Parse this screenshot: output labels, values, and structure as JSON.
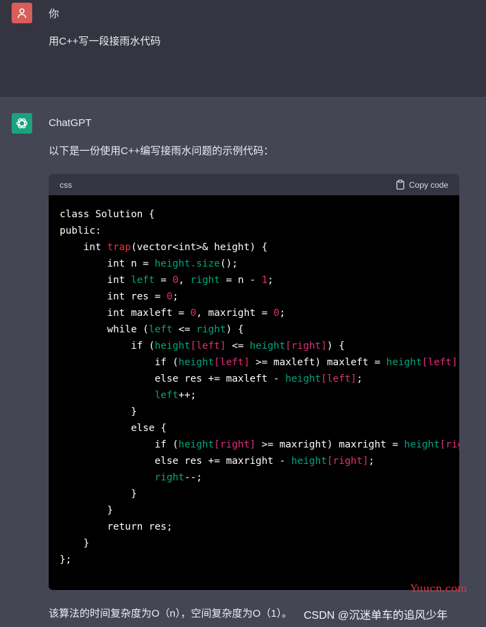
{
  "user": {
    "name": "你",
    "message": "用C++写一段接雨水代码"
  },
  "assistant": {
    "name": "ChatGPT",
    "intro": "以下是一份使用C++编写接雨水问题的示例代码："
  },
  "code_block": {
    "language": "css",
    "copy_label": "Copy code",
    "lines": [
      "class Solution {",
      "public:",
      "    int trap(vector<int>& height) {",
      "        int n = height.size();",
      "        int left = 0, right = n - 1;",
      "        int res = 0;",
      "        int maxleft = 0, maxright = 0;",
      "        while (left <= right) {",
      "            if (height[left] <= height[right]) {",
      "                if (height[left] >= maxleft) maxleft = height[left];",
      "                else res += maxleft - height[left];",
      "                left++;",
      "            }",
      "            else {",
      "                if (height[right] >= maxright) maxright = height[right];",
      "                else res += maxright - height[right];",
      "                right--;",
      "            }",
      "        }",
      "        return res;",
      "    }",
      "};"
    ]
  },
  "footer_text": "该算法的时间复杂度为O（n），空间复杂度为O（1）。",
  "watermarks": {
    "site": "Yuucn.com",
    "csdn": "CSDN @沉迷单车的追风少年"
  },
  "icons": {
    "user_avatar": "person-icon",
    "gpt_avatar": "openai-logo-icon",
    "copy": "clipboard-icon"
  },
  "colors": {
    "user_bg": "#343541",
    "assistant_bg": "#444654",
    "user_avatar": "#d75e5a",
    "gpt_avatar": "#19a37f",
    "code_bg": "#000000",
    "keyword_fn": "#f22c3d",
    "identifier": "#00a67d",
    "number": "#df3079"
  }
}
